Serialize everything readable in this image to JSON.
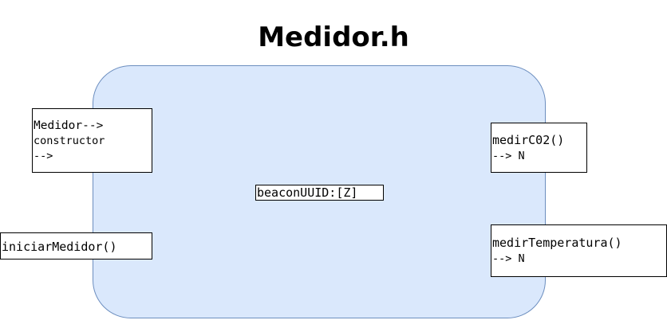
{
  "title": "Medidor.h",
  "colors": {
    "module_fill": "#dae8fc",
    "module_stroke": "#6c8ebf",
    "box_fill": "#ffffff",
    "box_stroke": "#000000"
  },
  "module": {
    "attribute": "beaconUUID:[Z]"
  },
  "inputs": {
    "constructor": {
      "line1": "Medidor-->",
      "line2": "constructor",
      "line3": "-->"
    },
    "iniciar": {
      "line1": "iniciarMedidor()"
    }
  },
  "outputs": {
    "co2": {
      "line1": "medirC02()",
      "line2": "--> N"
    },
    "temperatura": {
      "line1": "medirTemperatura()",
      "line2": "--> N"
    }
  }
}
